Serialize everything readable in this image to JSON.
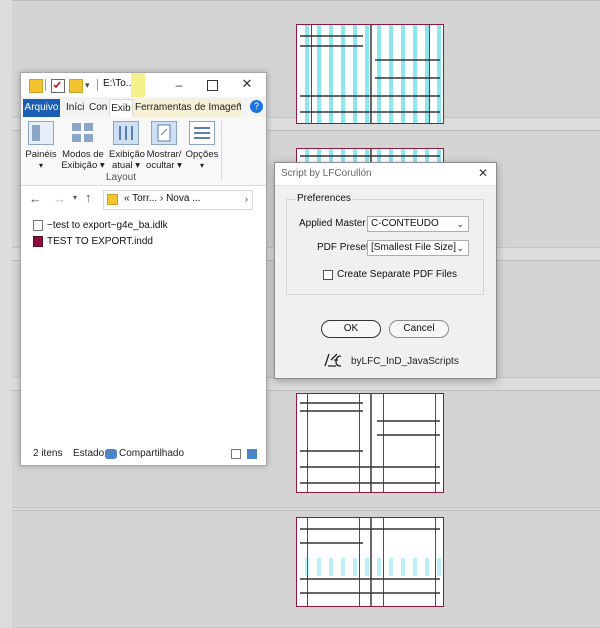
{
  "explorer": {
    "title": "E:\\To...",
    "tabs": {
      "arquivo": "Arquivo",
      "inicio": "Iníci",
      "compartilhar": "Con",
      "exibir": "Exib",
      "ferramentas": "Ferramentas de Imagem"
    },
    "ribbon": {
      "paineis": "Painéis",
      "modos_line1": "Modos de",
      "modos_line2": "Exibição",
      "exibicao_line1": "Exibição",
      "exibicao_line2": "atual",
      "mostrar_line1": "Mostrar/",
      "mostrar_line2": "ocultar",
      "opcoes": "Opções",
      "group_label": "Layout"
    },
    "address": {
      "part1": "Torr...",
      "part2": "Nova ..."
    },
    "files": [
      {
        "name": "~test to export~g4e_ba.idlk",
        "icon": "lock-file-icon"
      },
      {
        "name": "TEST TO EXPORT.indd",
        "icon": "indesign-file-icon"
      }
    ],
    "status": {
      "count": "2 itens",
      "state_label": "Estado:",
      "state_value": "Compartilhado"
    }
  },
  "dialog": {
    "title": "Script by LFCorullón",
    "group_title": "Preferences",
    "applied_master_label": "Applied Master",
    "applied_master_value": "C-CONTEUDO",
    "pdf_preset_label": "PDF Preset",
    "pdf_preset_value": "[Smallest File Size]",
    "checkbox_label": "Create Separate PDF Files",
    "checkbox_checked": false,
    "ok_label": "OK",
    "cancel_label": "Cancel",
    "credit": "byLFC_InD_JavaScripts"
  },
  "colors": {
    "accent": "#1a5fb4",
    "page_border": "#8c1a3b",
    "guide_magenta": "#c000c0",
    "guide_cyan": "#00c8dc"
  }
}
